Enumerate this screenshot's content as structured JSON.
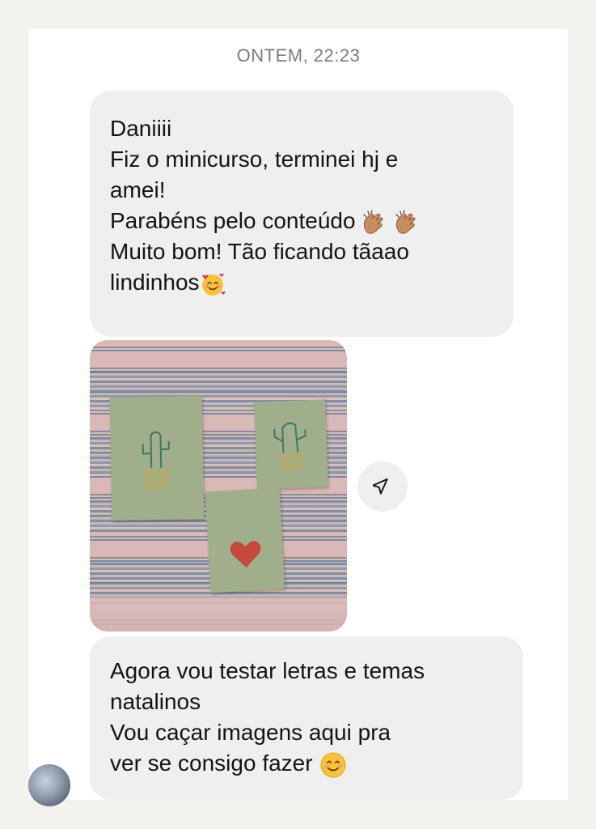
{
  "thread": {
    "timestamp": "ONTEM, 22:23"
  },
  "messages": [
    {
      "type": "text",
      "lines": [
        "Daniiii",
        "Fiz o minicurso, terminei hj e",
        "amei!",
        "Parabéns pelo conteúdo",
        "Muito bom! Tão ficando tãaao",
        "lindinhos"
      ],
      "emojis": [
        "clapping-hands",
        "clapping-hands",
        "smiling-face-with-hearts"
      ]
    },
    {
      "type": "photo",
      "icon": "image-attachment"
    },
    {
      "type": "text",
      "lines": [
        "Agora vou testar letras e temas",
        "natalinos",
        "Vou caçar imagens aqui pra",
        "ver se consigo fazer"
      ],
      "emojis": [
        "smiling-face-with-smiling-eyes"
      ]
    }
  ],
  "actions": {
    "share_icon": "paper-plane-icon"
  },
  "sender": {
    "avatar_icon": "avatar"
  },
  "colors": {
    "background": "#f4f2ef",
    "card": "#ffffff",
    "bubble": "#efefef",
    "text": "#141414",
    "timestamp": "#7b7b7b"
  }
}
